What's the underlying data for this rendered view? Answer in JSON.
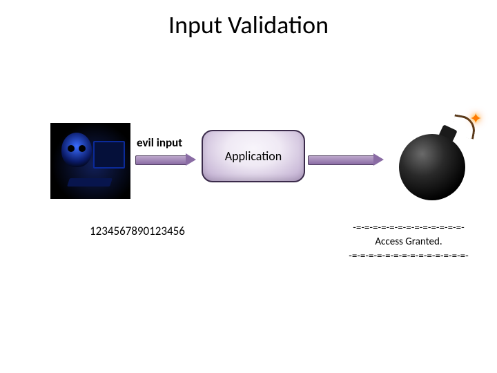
{
  "title": "Input Validation",
  "evil_label": "evil input",
  "app_label": "Application",
  "card_number": "1234567890123456",
  "access": {
    "rule_top": "-=-=-=-=-=-=-=-=-=-=-=-=-=-",
    "message": "Access Granted.",
    "rule_bottom": "-=-=-=-=-=-=-=-=-=-=-=-=-=-=-"
  },
  "icons": {
    "hacker": "hacker-skeleton",
    "bomb": "bomb",
    "spark_glyph": "✦"
  }
}
